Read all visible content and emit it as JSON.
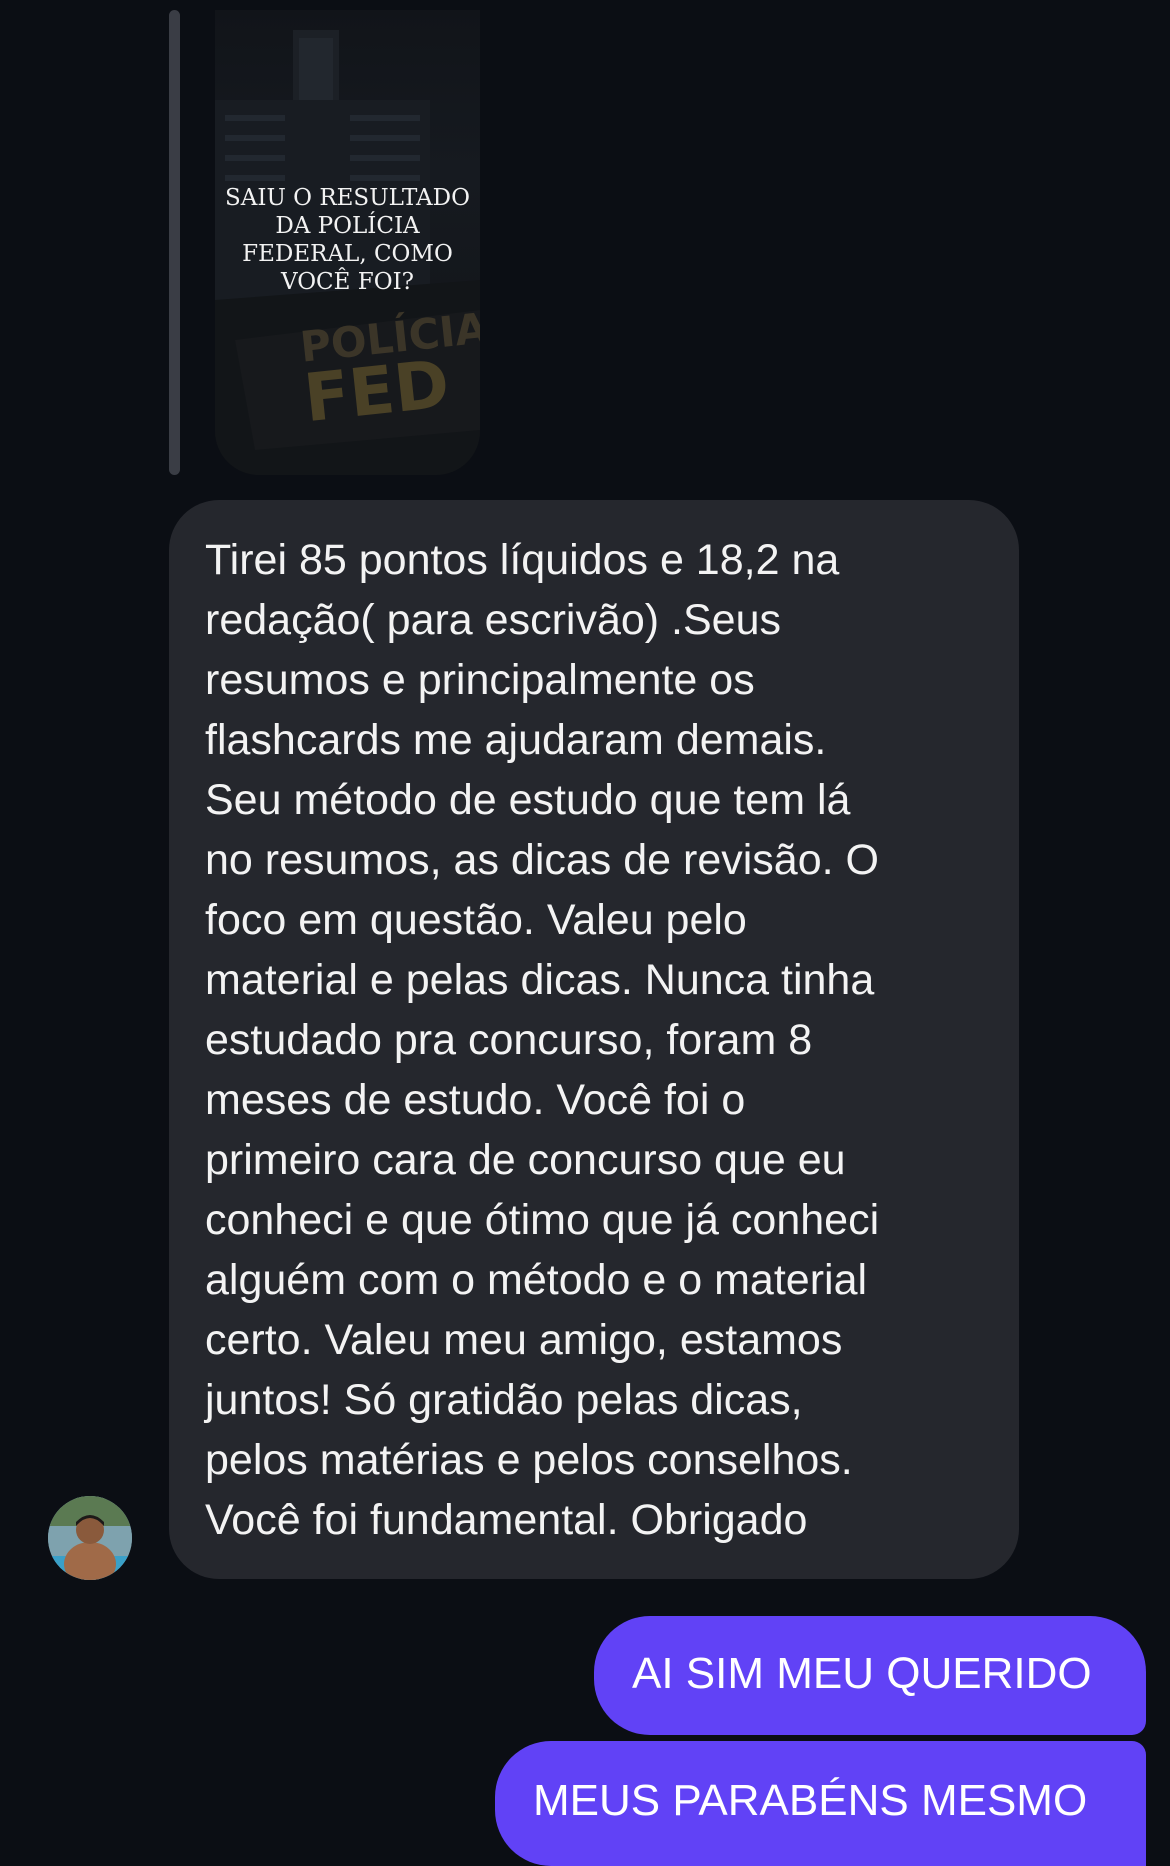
{
  "story_reply": {
    "caption": "SAIU O RESULTADO\nDA POLÍCIA\nFEDERAL, COMO\nVOCÊ FOI?",
    "image_description_icon": "police-building-photo",
    "background_text_1": "POLÍCIA",
    "background_text_2": "FED"
  },
  "incoming_message": {
    "text": "Tirei 85 pontos líquidos e 18,2 na\nredação( para escrivão) .Seus\nresumos e principalmente os\nflashcards me ajudaram demais.\nSeu método de estudo que tem lá\nno resumos, as dicas de revisão. O\nfoco em questão. Valeu pelo\nmaterial e pelas dicas. Nunca tinha\nestudado pra concurso, foram 8\nmeses de estudo. Você foi o\nprimeiro cara de concurso que eu\nconheci e que ótimo que já conheci\nalguém com o método e o material\ncerto. Valeu meu amigo, estamos\njuntos! Só gratidão pelas dicas,\npelos matérias e pelos conselhos.\nVocê foi fundamental. Obrigado"
  },
  "sender": {
    "avatar_icon": "user-avatar"
  },
  "outgoing_messages": [
    {
      "text": "AI SIM MEU QUERIDO"
    },
    {
      "text": "MEUS PARABÉNS MESMO"
    }
  ],
  "colors": {
    "background": "#0b0e14",
    "incoming_bubble": "#25272d",
    "outgoing_bubble": "#6142f6",
    "reply_bar": "#3a3d45"
  }
}
